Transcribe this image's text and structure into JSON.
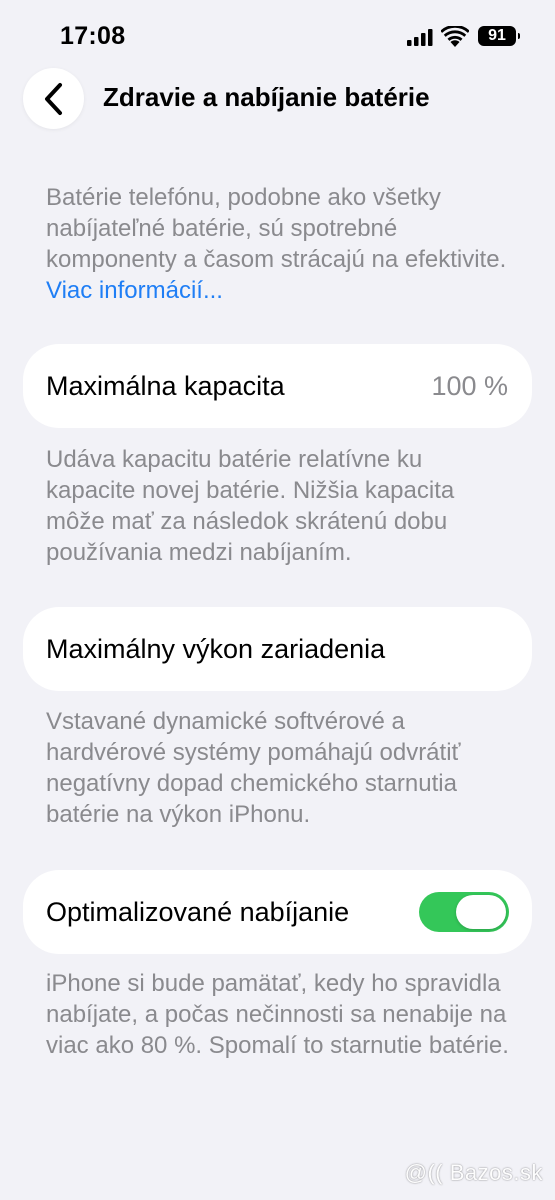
{
  "status_bar": {
    "time": "17:08",
    "battery_level": "91",
    "icons": [
      "signal-icon",
      "wifi-icon",
      "battery-icon"
    ]
  },
  "nav": {
    "back_icon": "chevron-left-icon",
    "title": "Zdravie a nabíjanie batérie"
  },
  "intro": {
    "text": "Batérie telefónu, podobne ako všetky nabíjateľné batérie, sú spotrebné komponenty a časom strácajú na efektivite. ",
    "link_label": "Viac informácií..."
  },
  "max_capacity": {
    "label": "Maximálna kapacita",
    "value": "100 %",
    "description": "Udáva kapacitu batérie relatívne ku kapacite novej batérie. Nižšia kapacita môže mať za následok skrátenú dobu používania medzi nabíjaním."
  },
  "peak_performance": {
    "label": "Maximálny výkon zariadenia",
    "description": "Vstavané dynamické softvérové a hardvérové systémy pomáhajú odvrátiť negatívny dopad chemického starnutia batérie na výkon iPhonu."
  },
  "optimized_charging": {
    "label": "Optimalizované nabíjanie",
    "enabled": true,
    "toggle_color": "#34c759",
    "description": "iPhone si bude pamätať, kedy ho spravidla nabíjate, a počas nečinnosti sa nenabije na viac ako 80 %. Spomalí to starnutie batérie."
  },
  "watermark": {
    "text": "@(( Bazos.sk"
  },
  "colors": {
    "background": "#f2f2f7",
    "card": "#ffffff",
    "secondary_text": "#8a8a8e",
    "link": "#1f7ef5"
  }
}
